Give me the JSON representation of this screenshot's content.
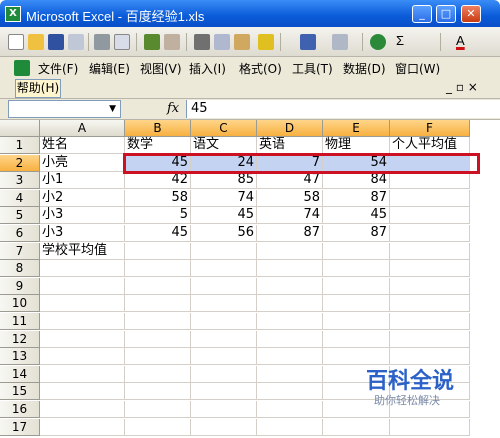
{
  "window": {
    "title": "Microsoft Excel - 百度经验1.xls"
  },
  "toolbar": {
    "sigma": "Σ",
    "font_color": "A"
  },
  "menu": [
    {
      "label": "文件(F)"
    },
    {
      "label": "编辑(E)"
    },
    {
      "label": "视图(V)"
    },
    {
      "label": "插入(I)"
    },
    {
      "label": "格式(O)"
    },
    {
      "label": "工具(T)"
    },
    {
      "label": "数据(D)"
    },
    {
      "label": "窗口(W)"
    }
  ],
  "help_button": "帮助(H)",
  "formula": {
    "name_box": "",
    "fx": "fx",
    "value": "45"
  },
  "columns": [
    "A",
    "B",
    "C",
    "D",
    "E",
    "F"
  ],
  "rows": [
    "1",
    "2",
    "3",
    "4",
    "5",
    "6",
    "7",
    "8",
    "9",
    "10",
    "11",
    "12",
    "13",
    "14",
    "15",
    "16",
    "17"
  ],
  "cells": {
    "A1": "姓名",
    "B1": "数学",
    "C1": "语文",
    "D1": "英语",
    "E1": "物理",
    "F1": "个人平均值",
    "A2": "小亮",
    "B2": "45",
    "C2": "24",
    "D2": "7",
    "E2": "54",
    "A3": "小1",
    "B3": "42",
    "C3": "85",
    "D3": "47",
    "E3": "84",
    "A4": "小2",
    "B4": "58",
    "C4": "74",
    "D4": "58",
    "E4": "87",
    "A5": "小3",
    "B5": "5",
    "C5": "45",
    "D5": "74",
    "E5": "45",
    "A6": "小3",
    "B6": "45",
    "C6": "56",
    "D6": "87",
    "E6": "87",
    "A7": "学校平均值"
  },
  "watermark": {
    "main": "百科全说",
    "sub": "助你轻松解决"
  }
}
